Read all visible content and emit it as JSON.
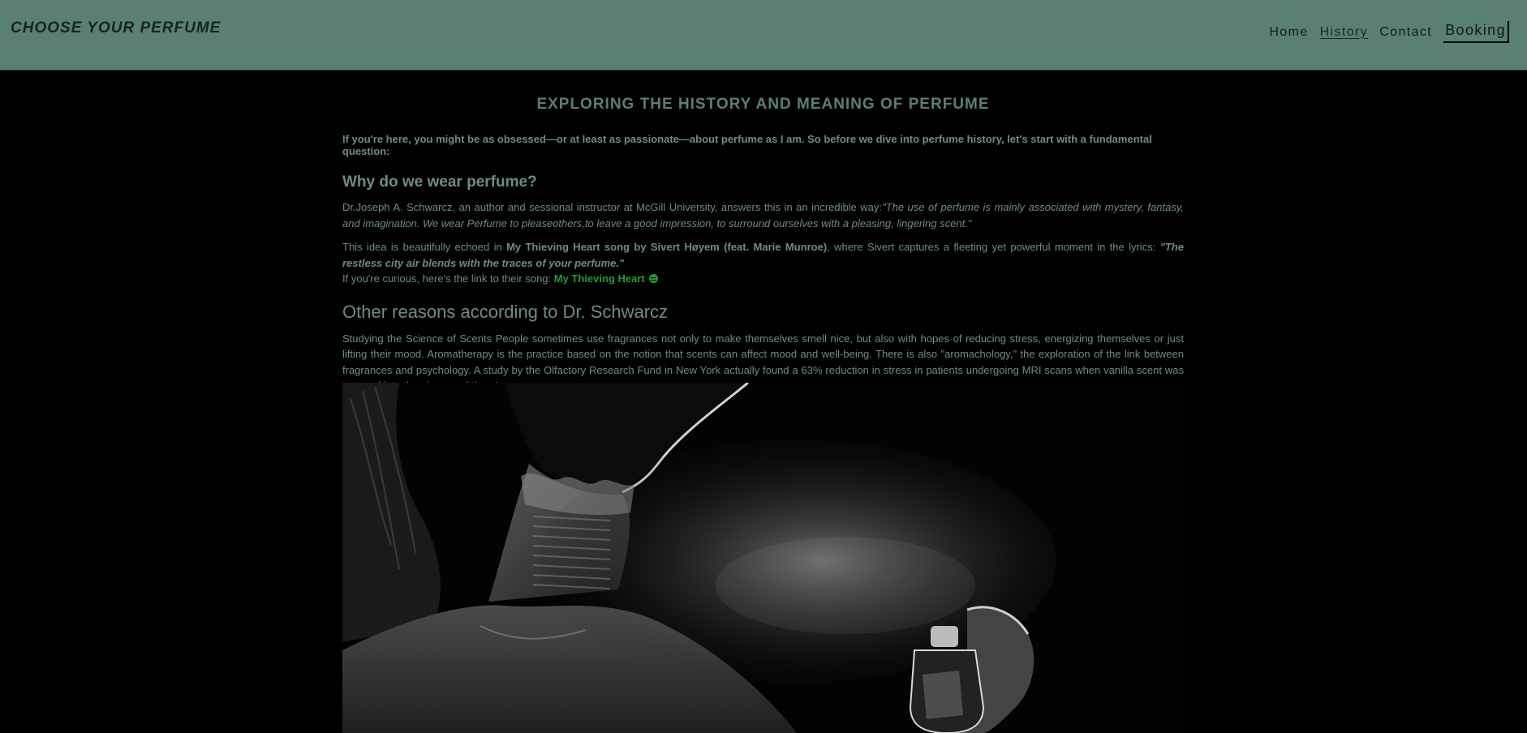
{
  "header": {
    "brand": "CHOOSE YOUR PERFUME",
    "nav": [
      {
        "label": "Home"
      },
      {
        "label": "History"
      },
      {
        "label": "Contact"
      },
      {
        "label": "Booking"
      }
    ]
  },
  "main": {
    "title": "EXPLORING THE HISTORY AND MEANING OF PERFUME",
    "intro": "If you're here, you might be as obsessed—or at least as passionate—about perfume as I am. So before we dive into perfume history, let's start with a fundamental question:",
    "section1": {
      "heading": "Why do we wear perfume?",
      "p1_text": "Dr.Joseph A. Schwarcz, an author and sessional instructor at McGill University, answers this in an incredible way:",
      "p1_quote": "\"The use of perfume is mainly associated with mystery, fantasy, and imagination. We wear Perfume to pleaseothers,to leave a good impression, to surround ourselves with a pleasing, lingering scent.\"",
      "p2_pre": "This idea is beautifully echoed in ",
      "p2_song": "My Thieving Heart song by Sivert Høyem (feat. Marie Munroe)",
      "p2_mid": ", where Sivert captures a fleeting yet powerful moment in the lyrics: ",
      "p2_lyric": "\"The restless city air blends with the traces of your perfume.\"",
      "p3_pre": "If you're curious, here's the link to their song: ",
      "p3_link": "My Thieving Heart"
    },
    "section2": {
      "heading": "Other reasons according to Dr. Schwarcz",
      "body": "Studying the Science of Scents People sometimes use fragrances not only to make themselves smell nice, but also with hopes of reducing stress, energizing themselves or just lifting their mood. Aromatherapy is the practice based on the notion that scents can affect mood and well-being. There is also \"aromachology,\" the exploration of the link between fragrances and psychology. A study by the Olfactory Research Fund in New York actually found a 63% reduction in stress in patients undergoing MRI scans when vanilla scent was pumped into the air around them!"
    }
  },
  "icons": {
    "song_link_icon": "spotify-icon"
  },
  "colors": {
    "header_bg": "#5a7f73",
    "accent_text": "#6e8c82",
    "link_green": "#1f9d32",
    "page_bg": "#000000"
  }
}
